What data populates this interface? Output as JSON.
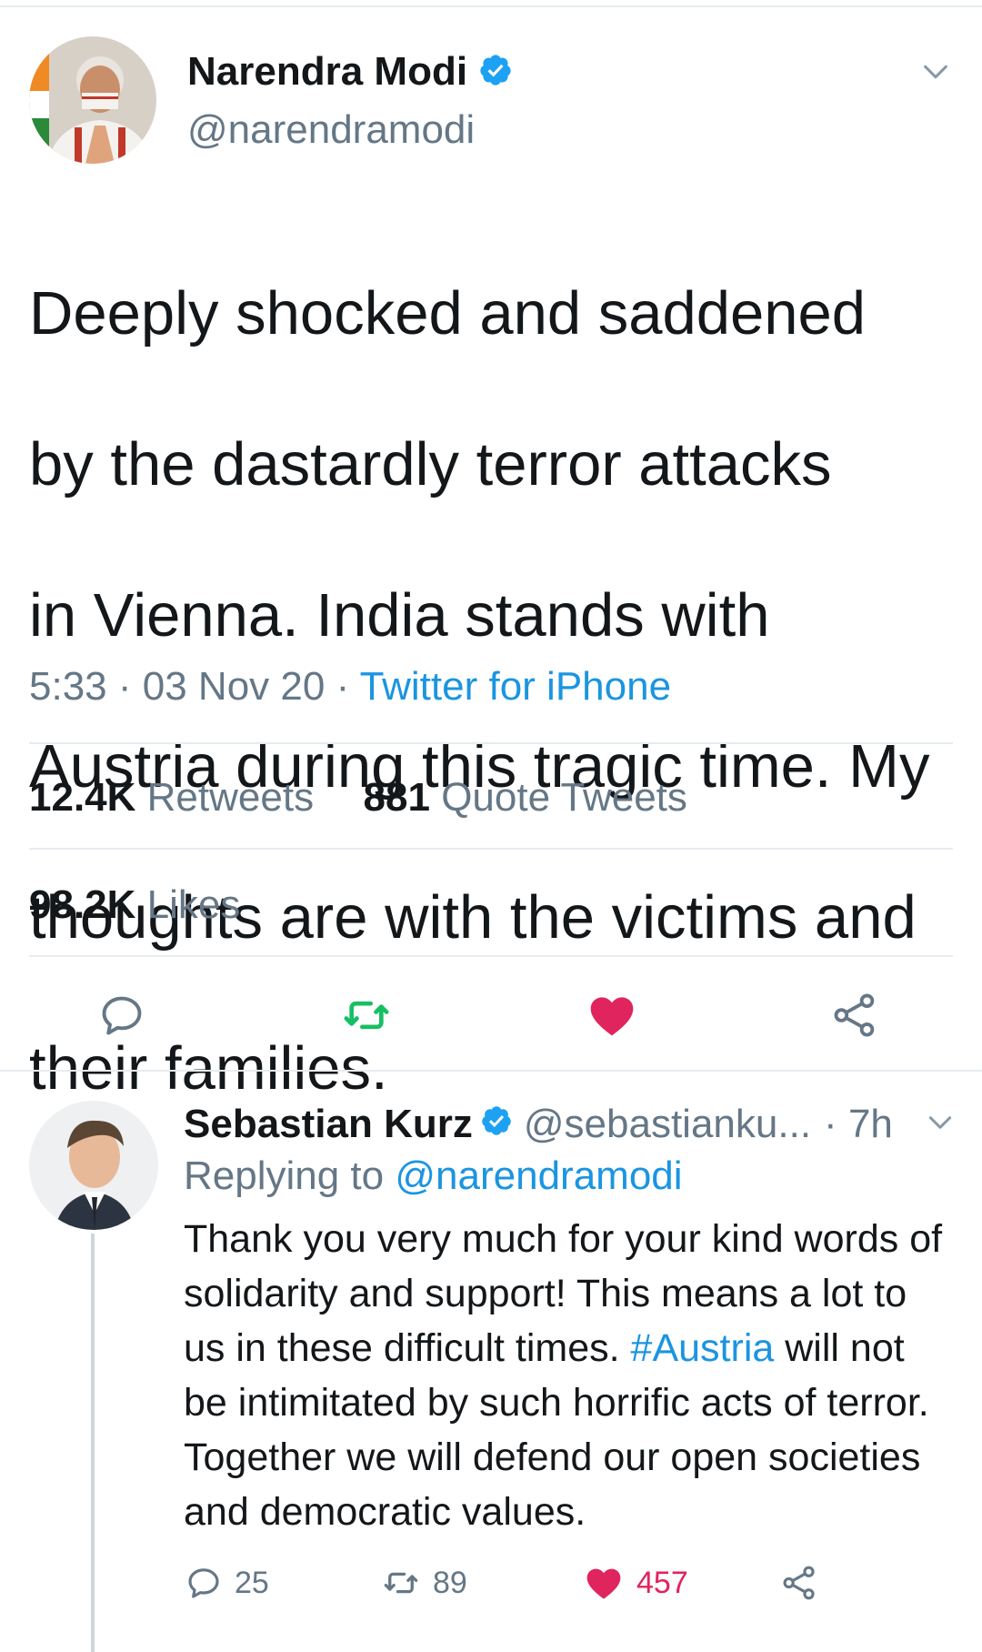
{
  "main_tweet": {
    "author_name": "Narendra Modi",
    "author_handle": "@narendramodi",
    "verified": true,
    "text_lines": [
      "Deeply shocked and saddened",
      "by the dastardly terror attacks",
      "in Vienna. India stands with",
      "Austria during this tragic time. My",
      "thoughts are with the victims and",
      "their families."
    ],
    "time": "5:33",
    "date": "03 Nov 20",
    "separator": "·",
    "source": "Twitter for iPhone",
    "retweets_count": "12.4K",
    "retweets_label": "Retweets",
    "quotes_count": "881",
    "quotes_label": "Quote Tweets",
    "likes_count": "98.2K",
    "likes_label": "Likes",
    "liked": true
  },
  "reply_tweet": {
    "author_name": "Sebastian Kurz",
    "author_handle": "@sebastianku...",
    "verified": true,
    "time_ago": "7h",
    "separator": "·",
    "replying_prefix": "Replying to",
    "replying_to": "@narendramodi",
    "text_part1": "Thank you very much for your kind words of solidarity and support! This means a lot to us in these difficult times. ",
    "hashtag": "#Austria",
    "text_part2": " will not be intimitated by such horrific acts of terror. Together we will defend our open societies and democratic values.",
    "reply_count": "25",
    "retweet_count": "89",
    "like_count": "457",
    "liked": true
  },
  "colors": {
    "text_primary": "#14171a",
    "text_secondary": "#657786",
    "link_blue": "#1b95e0",
    "verified_blue": "#1da1f2",
    "retweet_green": "#17bf63",
    "like_red": "#e0245e",
    "border": "#e6ecf0"
  },
  "icons": {
    "reply": "speech-bubble-icon",
    "retweet": "retweet-arrows-icon",
    "like": "heart-icon",
    "share": "share-nodes-icon",
    "more": "chevron-down-icon",
    "verified": "verified-badge-icon"
  }
}
